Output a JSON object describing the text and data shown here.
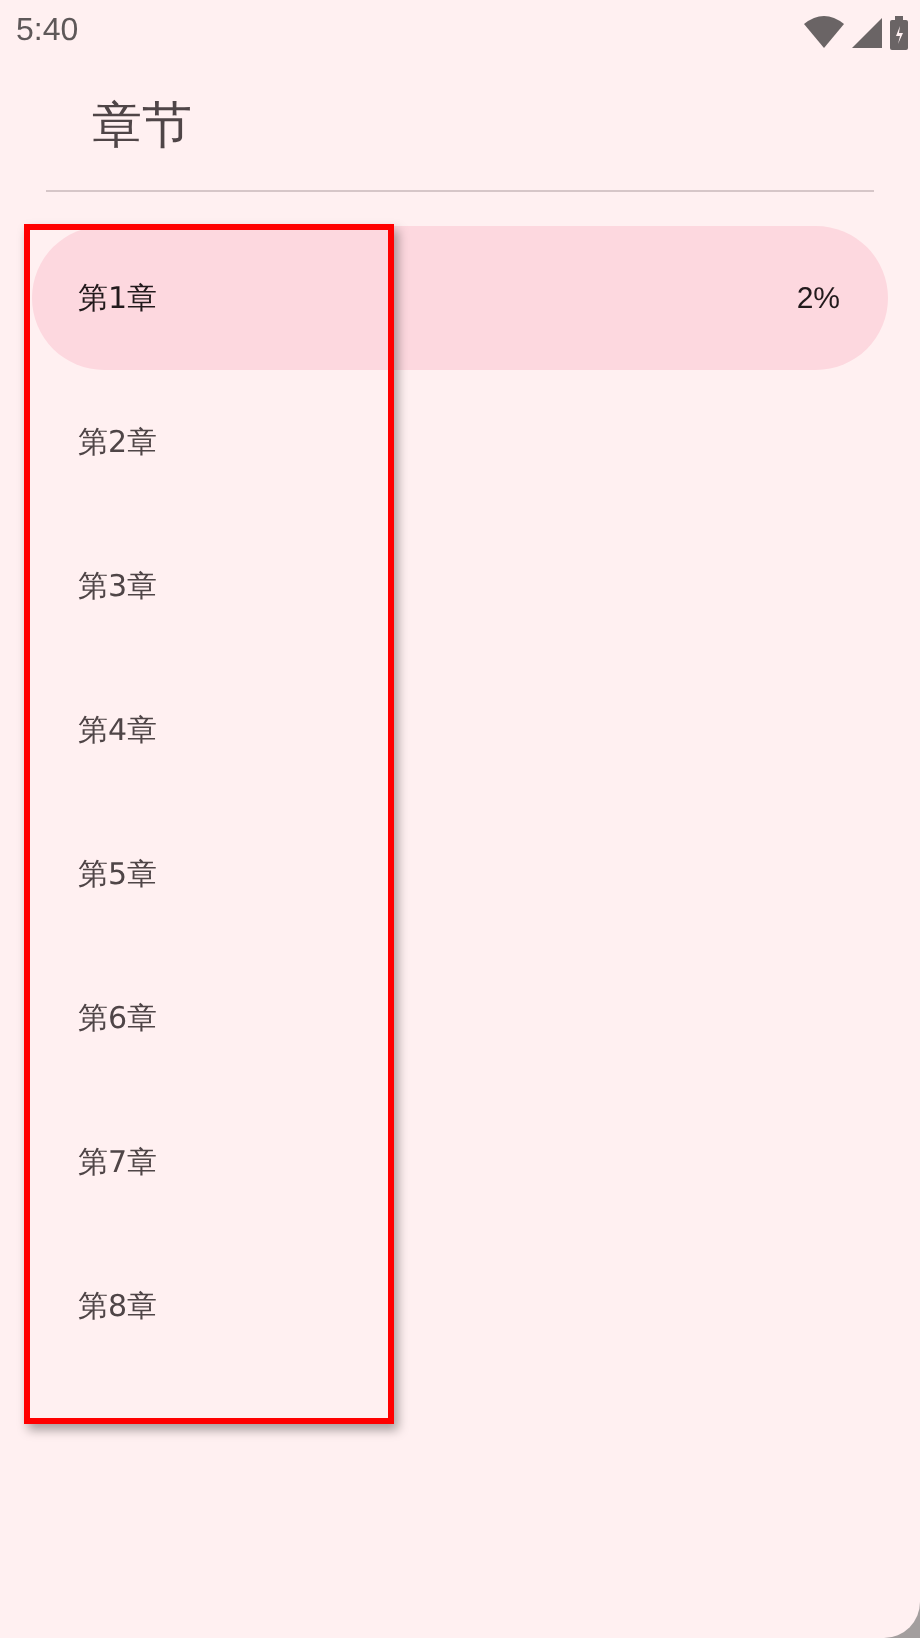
{
  "status_bar": {
    "time": "5:40"
  },
  "title": "章节",
  "chapters": [
    {
      "label": "第1章",
      "progress": "2%",
      "selected": true
    },
    {
      "label": "第2章",
      "selected": false
    },
    {
      "label": "第3章",
      "selected": false
    },
    {
      "label": "第4章",
      "selected": false
    },
    {
      "label": "第5章",
      "selected": false
    },
    {
      "label": "第6章",
      "selected": false
    },
    {
      "label": "第7章",
      "selected": false
    },
    {
      "label": "第8章",
      "selected": false
    }
  ],
  "highlight": {
    "kind": "frame"
  }
}
